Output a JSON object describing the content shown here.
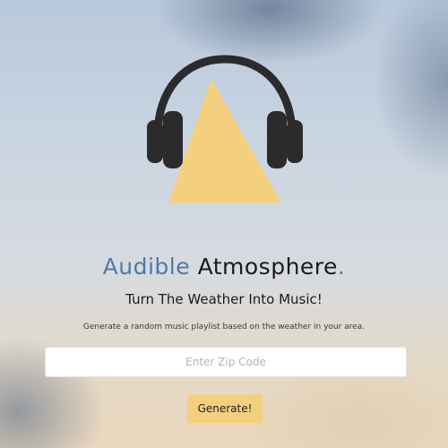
{
  "brand": {
    "word1": "Audible",
    "word2": "Atmosphere",
    "dot": "."
  },
  "tagline": "Turn The Weather Into Music!",
  "description": "Generate a random music playlist based on the weather in your area.",
  "zip": {
    "placeholder": "Enter Zip Code",
    "value": ""
  },
  "generate_label": "Generate!",
  "colors": {
    "accent_blue": "#4f7aa6",
    "accent_yellow": "#f4d07e",
    "headphone": "#2b2b2b"
  },
  "logo_icon": "headphones-icon"
}
